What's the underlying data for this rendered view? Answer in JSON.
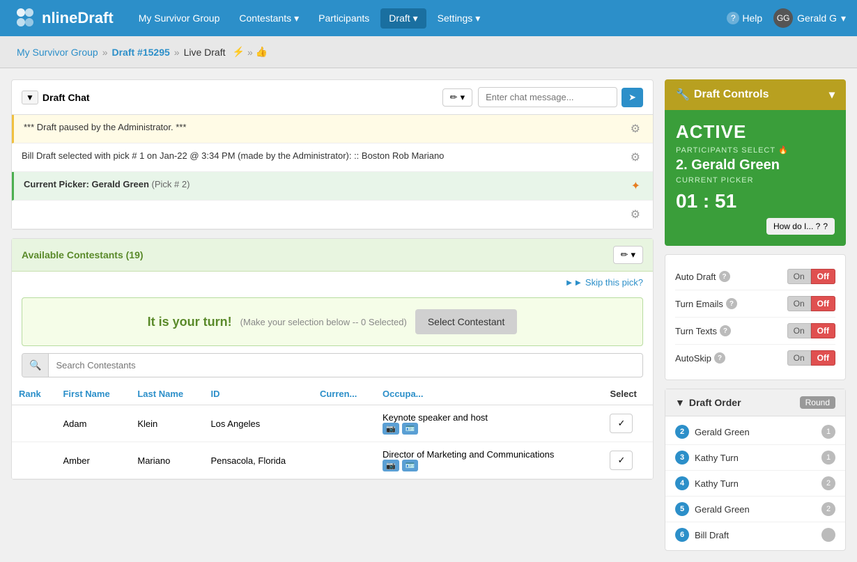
{
  "header": {
    "logo_text": "nlineDraft",
    "logo_prefix": "O",
    "nav_items": [
      {
        "label": "My Survivor Group",
        "active": false
      },
      {
        "label": "Contestants",
        "dropdown": true,
        "active": false
      },
      {
        "label": "Participants",
        "active": false
      },
      {
        "label": "Draft",
        "dropdown": true,
        "active": true
      },
      {
        "label": "Settings",
        "dropdown": true,
        "active": false
      }
    ],
    "help_label": "Help",
    "user_label": "Gerald G"
  },
  "breadcrumb": {
    "home": "My Survivor Group",
    "draft": "Draft #15295",
    "live": "Live Draft"
  },
  "draft_chat": {
    "title": "Draft Chat",
    "input_placeholder": "Enter chat message...",
    "messages": [
      {
        "type": "admin_notice",
        "text": "*** Draft paused by the Administrator. ***"
      },
      {
        "type": "draft_pick",
        "text": "Bill Draft selected with pick # 1 on Jan-22 @ 3:34 PM (made by the Administrator):\n:: Boston Rob Mariano"
      },
      {
        "type": "current_picker",
        "text": "Current Picker: Gerald Green",
        "sub": "(Pick # 2)"
      }
    ]
  },
  "available_contestants": {
    "title": "Available Contestants (19)",
    "skip_link": "►► Skip this pick?",
    "your_turn_text": "It is your turn!",
    "your_turn_sub": "(Make your selection below -- 0 Selected)",
    "select_btn": "Select Contestant",
    "search_placeholder": "Search Contestants",
    "table_headers": [
      "Rank",
      "First Name",
      "Last Name",
      "ID",
      "Curren...",
      "Occupa...",
      "Select"
    ],
    "contestants": [
      {
        "rank": "",
        "first_name": "Adam",
        "last_name": "Klein",
        "id": "Los Angeles",
        "current": "Los Angeles",
        "occupation": "Keynote speaker and host",
        "has_media": true
      },
      {
        "rank": "",
        "first_name": "Amber",
        "last_name": "Mariano",
        "id": "Pensacola, Florida",
        "current": "Pensacola, Florida",
        "occupation": "Director of Marketing and Communications",
        "has_media": true
      }
    ]
  },
  "draft_controls": {
    "title": "Draft Controls",
    "status": "ACTIVE",
    "participants_select_label": "PARTICIPANTS SELECT",
    "current_picker_num": "2.",
    "current_picker_name": "Gerald Green",
    "current_picker_label": "CURRENT PICKER",
    "timer": "01 : 51",
    "how_do_i_btn": "How do I... ?"
  },
  "toggles": [
    {
      "label": "Auto Draft",
      "has_help": true,
      "state": "off"
    },
    {
      "label": "Turn Emails",
      "has_help": true,
      "state": "off"
    },
    {
      "label": "Turn Texts",
      "has_help": true,
      "state": "off"
    },
    {
      "label": "AutoSkip",
      "has_help": true,
      "state": "off"
    }
  ],
  "draft_order": {
    "title": "Draft Order",
    "round_label": "Round",
    "items": [
      {
        "num": 2,
        "name": "Gerald Green",
        "round": 1,
        "color": "#2c8fc9"
      },
      {
        "num": 3,
        "name": "Kathy Turn",
        "round": 1,
        "color": "#2c8fc9"
      },
      {
        "num": 4,
        "name": "Kathy Turn",
        "round": 2,
        "color": "#2c8fc9"
      },
      {
        "num": 5,
        "name": "Gerald Green",
        "round": 2,
        "color": "#2c8fc9"
      },
      {
        "num": 6,
        "name": "Bill Draft",
        "round": null,
        "color": "#2c8fc9"
      }
    ]
  }
}
